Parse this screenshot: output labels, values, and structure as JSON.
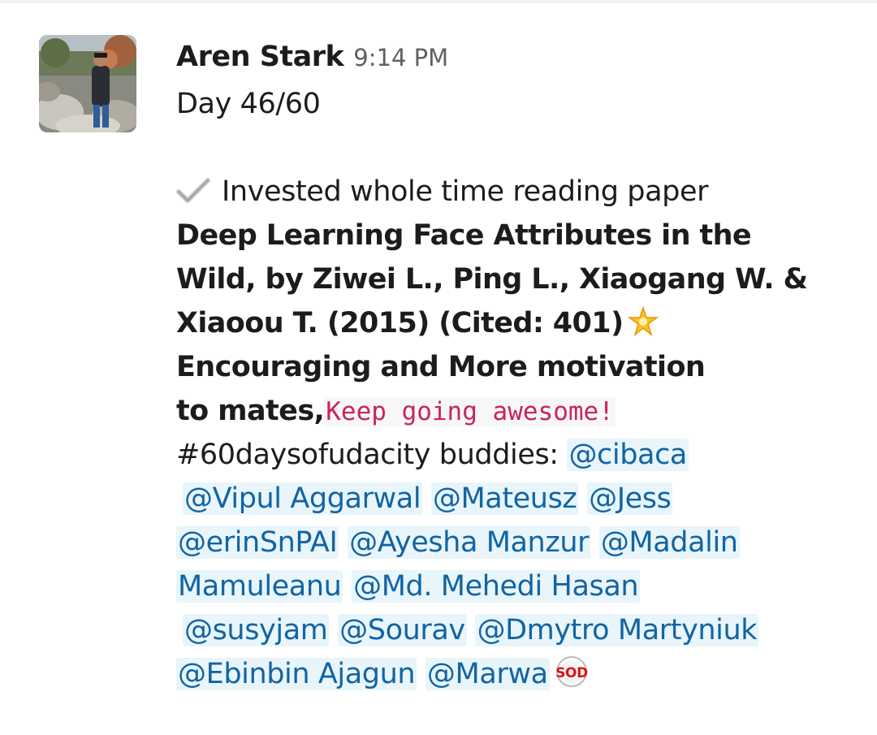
{
  "message": {
    "sender": "Aren Stark",
    "time": "9:14 PM",
    "day_line": "Day 46/60",
    "line1": "Invested whole time reading paper",
    "line2": "Deep Learning Face Attributes in the",
    "line3": "Wild, by Ziwei L., Ping L., Xiaogang W. &",
    "line4": "Xiaoou T. (2015) (Cited: 401)",
    "line5": "Encouraging and More motivation",
    "line6_bold": "to mates,",
    "line6_code": "Keep going awesome!",
    "line7_prefix": "#60daysofudacity buddies: ",
    "mentions": [
      "@cibaca",
      "@Vipul Aggarwal",
      "@Mateusz",
      "@Jess",
      "@erinSnPAI",
      "@Ayesha Manzur",
      "@Madalin",
      "Mamuleanu",
      "@Md. Mehedi Hasan",
      "@susyjam",
      "@Sourav",
      "@Dmytro Martyniuk",
      "@Ebinbin Ajagun",
      "@Marwa"
    ],
    "sod_emoji_text": "SOD"
  },
  "icons": {
    "check": "check-mark-icon",
    "star": "glowing-star-icon",
    "custom_emoji": "sod-badge-icon"
  },
  "colors": {
    "text": "#1d1c1d",
    "timestamp": "#616061",
    "mention_text": "#1264a3",
    "mention_bg": "#e8f5fa",
    "code_text": "#c9245e"
  }
}
